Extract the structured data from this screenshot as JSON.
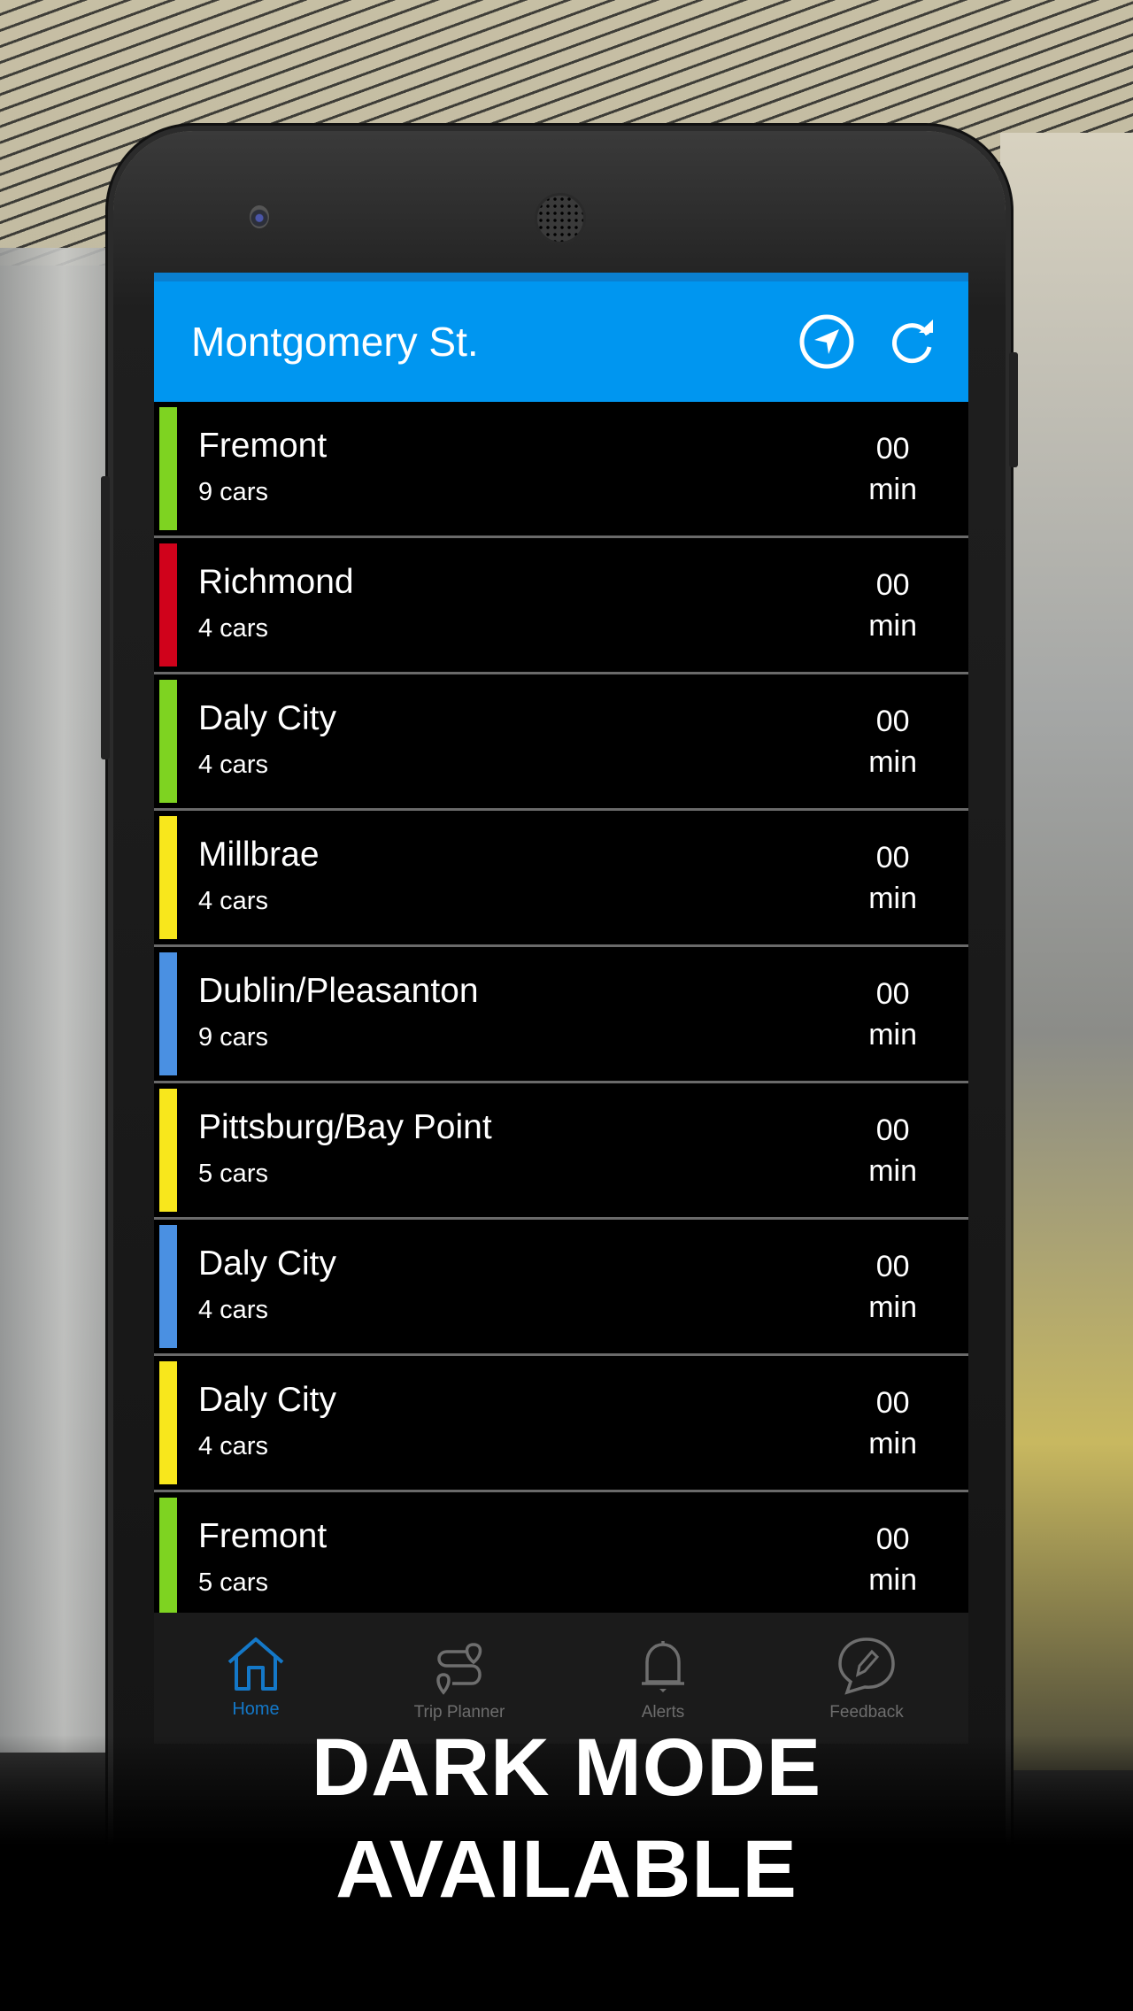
{
  "header": {
    "title": "Montgomery St.",
    "icons": [
      "navigation-arrow-icon",
      "refresh-icon"
    ]
  },
  "colors": {
    "accent": "#0096f0",
    "green": "#7ed321",
    "red": "#d0021b",
    "yellow": "#f8e71c",
    "blue": "#4a90e2",
    "tab_active": "#1478c8",
    "tab_inactive": "#6e6e6e"
  },
  "departures": [
    {
      "destination": "Fremont",
      "cars": "9 cars",
      "eta_value": "00",
      "eta_unit": "min",
      "line_color": "#7ed321"
    },
    {
      "destination": "Richmond",
      "cars": "4 cars",
      "eta_value": "00",
      "eta_unit": "min",
      "line_color": "#d0021b"
    },
    {
      "destination": "Daly City",
      "cars": "4 cars",
      "eta_value": "00",
      "eta_unit": "min",
      "line_color": "#7ed321"
    },
    {
      "destination": "Millbrae",
      "cars": "4 cars",
      "eta_value": "00",
      "eta_unit": "min",
      "line_color": "#f8e71c"
    },
    {
      "destination": "Dublin/Pleasanton",
      "cars": "9 cars",
      "eta_value": "00",
      "eta_unit": "min",
      "line_color": "#4a90e2"
    },
    {
      "destination": "Pittsburg/Bay Point",
      "cars": "5 cars",
      "eta_value": "00",
      "eta_unit": "min",
      "line_color": "#f8e71c"
    },
    {
      "destination": "Daly City",
      "cars": "4 cars",
      "eta_value": "00",
      "eta_unit": "min",
      "line_color": "#4a90e2"
    },
    {
      "destination": "Daly City",
      "cars": "4 cars",
      "eta_value": "00",
      "eta_unit": "min",
      "line_color": "#f8e71c"
    },
    {
      "destination": "Fremont",
      "cars": "5 cars",
      "eta_value": "00",
      "eta_unit": "min",
      "line_color": "#7ed321"
    }
  ],
  "tabs": [
    {
      "label": "Home",
      "icon": "home-icon",
      "active": true
    },
    {
      "label": "Trip Planner",
      "icon": "route-icon",
      "active": false
    },
    {
      "label": "Alerts",
      "icon": "bell-icon",
      "active": false
    },
    {
      "label": "Feedback",
      "icon": "feedback-icon",
      "active": false
    }
  ],
  "caption": {
    "line1": "DARK MODE",
    "line2": "AVAILABLE"
  }
}
